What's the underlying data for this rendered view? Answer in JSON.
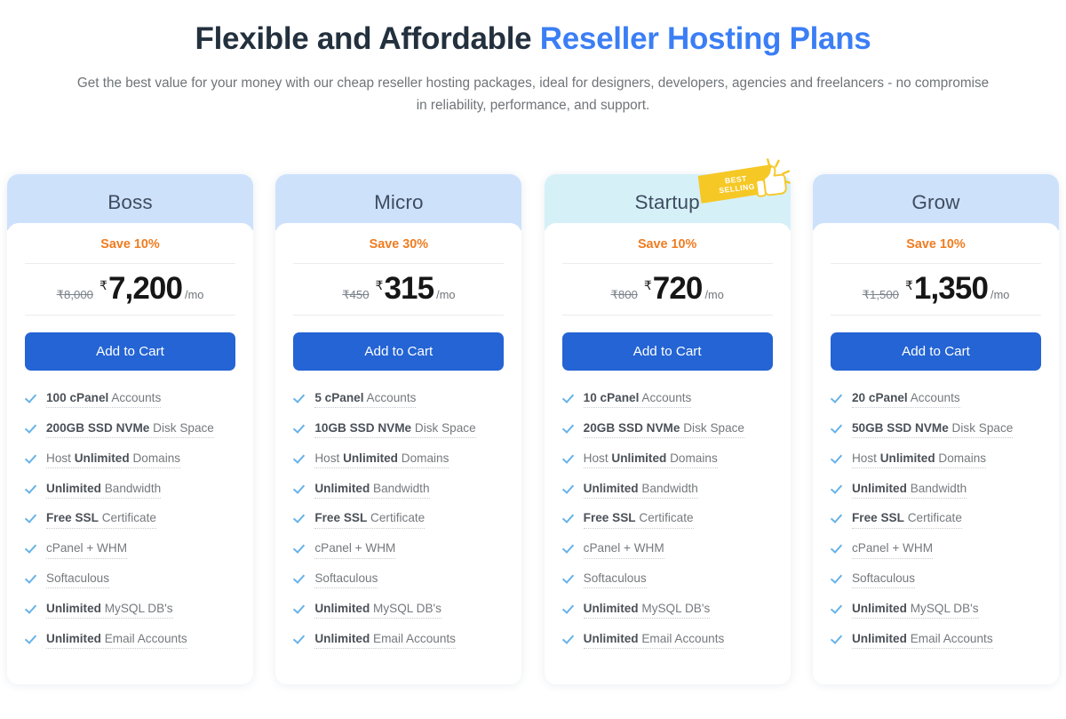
{
  "hero": {
    "title_plain": "Flexible and Affordable ",
    "title_accent": "Reseller Hosting Plans",
    "subtitle": "Get the best value for your money with our cheap reseller hosting packages, ideal for designers, developers, agencies and freelancers - no compromise in reliability, performance, and support."
  },
  "colors": {
    "accent_blue": "#3b7ef5",
    "button_blue": "#2464d4",
    "save_orange": "#ef7c20",
    "header_blue": "#cde1fb",
    "header_cyan": "#d6f0f8",
    "badge_gold": "#f6c825",
    "check_blue": "#66b2e8"
  },
  "badge": {
    "line1": "BEST",
    "line2": "SELLING",
    "icon": "thumbs-up-icon"
  },
  "currency_symbol": "₹",
  "per_label": "/mo",
  "cta_label": "Add to Cart",
  "plans": [
    {
      "name": "Boss",
      "save": "Save 10%",
      "old_price": "₹8,000",
      "price": "7,200",
      "best_selling": false,
      "header_tint": "blue",
      "features": [
        {
          "bold": "100 cPanel",
          "rest": " Accounts",
          "lead": ""
        },
        {
          "bold": "200GB SSD NVMe",
          "rest": " Disk Space",
          "lead": ""
        },
        {
          "bold": "Unlimited",
          "rest": " Domains",
          "lead": "Host "
        },
        {
          "bold": "Unlimited",
          "rest": " Bandwidth",
          "lead": ""
        },
        {
          "bold": "Free SSL",
          "rest": " Certificate",
          "lead": ""
        },
        {
          "bold": "",
          "rest": "cPanel + WHM",
          "lead": ""
        },
        {
          "bold": "",
          "rest": "Softaculous",
          "lead": ""
        },
        {
          "bold": "Unlimited",
          "rest": " MySQL DB's",
          "lead": ""
        },
        {
          "bold": "Unlimited",
          "rest": " Email Accounts",
          "lead": ""
        }
      ]
    },
    {
      "name": "Micro",
      "save": "Save 30%",
      "old_price": "₹450",
      "price": "315",
      "best_selling": false,
      "header_tint": "blue",
      "features": [
        {
          "bold": "5 cPanel",
          "rest": " Accounts",
          "lead": ""
        },
        {
          "bold": "10GB SSD NVMe",
          "rest": " Disk Space",
          "lead": ""
        },
        {
          "bold": "Unlimited",
          "rest": " Domains",
          "lead": "Host "
        },
        {
          "bold": "Unlimited",
          "rest": " Bandwidth",
          "lead": ""
        },
        {
          "bold": "Free SSL",
          "rest": " Certificate",
          "lead": ""
        },
        {
          "bold": "",
          "rest": "cPanel + WHM",
          "lead": ""
        },
        {
          "bold": "",
          "rest": "Softaculous",
          "lead": ""
        },
        {
          "bold": "Unlimited",
          "rest": " MySQL DB's",
          "lead": ""
        },
        {
          "bold": "Unlimited",
          "rest": " Email Accounts",
          "lead": ""
        }
      ]
    },
    {
      "name": "Startup",
      "save": "Save 10%",
      "old_price": "₹800",
      "price": "720",
      "best_selling": true,
      "header_tint": "cyan",
      "features": [
        {
          "bold": "10 cPanel",
          "rest": " Accounts",
          "lead": ""
        },
        {
          "bold": "20GB SSD NVMe",
          "rest": " Disk Space",
          "lead": ""
        },
        {
          "bold": "Unlimited",
          "rest": " Domains",
          "lead": "Host "
        },
        {
          "bold": "Unlimited",
          "rest": " Bandwidth",
          "lead": ""
        },
        {
          "bold": "Free SSL",
          "rest": " Certificate",
          "lead": ""
        },
        {
          "bold": "",
          "rest": "cPanel + WHM",
          "lead": ""
        },
        {
          "bold": "",
          "rest": "Softaculous",
          "lead": ""
        },
        {
          "bold": "Unlimited",
          "rest": " MySQL DB's",
          "lead": ""
        },
        {
          "bold": "Unlimited",
          "rest": " Email Accounts",
          "lead": ""
        }
      ]
    },
    {
      "name": "Grow",
      "save": "Save 10%",
      "old_price": "₹1,500",
      "price": "1,350",
      "best_selling": false,
      "header_tint": "blue",
      "features": [
        {
          "bold": "20 cPanel",
          "rest": " Accounts",
          "lead": ""
        },
        {
          "bold": "50GB SSD NVMe",
          "rest": " Disk Space",
          "lead": ""
        },
        {
          "bold": "Unlimited",
          "rest": " Domains",
          "lead": "Host "
        },
        {
          "bold": "Unlimited",
          "rest": " Bandwidth",
          "lead": ""
        },
        {
          "bold": "Free SSL",
          "rest": " Certificate",
          "lead": ""
        },
        {
          "bold": "",
          "rest": "cPanel + WHM",
          "lead": ""
        },
        {
          "bold": "",
          "rest": "Softaculous",
          "lead": ""
        },
        {
          "bold": "Unlimited",
          "rest": " MySQL DB's",
          "lead": ""
        },
        {
          "bold": "Unlimited",
          "rest": " Email Accounts",
          "lead": ""
        }
      ]
    }
  ]
}
